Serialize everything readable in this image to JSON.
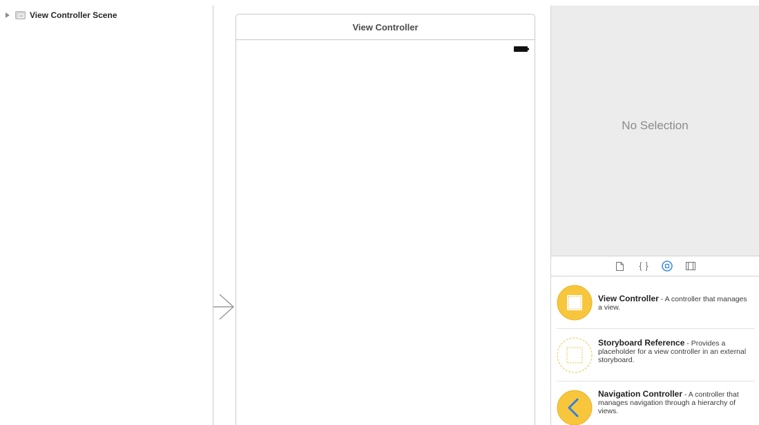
{
  "outline": {
    "scene_label": "View Controller Scene"
  },
  "canvas": {
    "scene_title": "View Controller"
  },
  "inspector": {
    "empty_text": "No Selection"
  },
  "library": {
    "tabs": [
      {
        "name": "file-template",
        "icon": "file-icon"
      },
      {
        "name": "code-snippet",
        "icon": "braces-icon"
      },
      {
        "name": "object",
        "icon": "circle-square-icon",
        "selected": true
      },
      {
        "name": "media",
        "icon": "film-icon"
      }
    ],
    "items": [
      {
        "name": "View Controller",
        "separator": " - ",
        "description": "A controller that manages a view."
      },
      {
        "name": "Storyboard Reference",
        "separator": " - ",
        "description": "Provides a placeholder for a view controller in an external storyboard."
      },
      {
        "name": "Navigation Controller",
        "separator": " - ",
        "description": "A controller that manages navigation through a hierarchy of views."
      }
    ]
  },
  "colors": {
    "accent_blue": "#3d8de8",
    "library_yellow": "#f8c63c",
    "library_yellow_border": "#e9b22a",
    "inspector_bg": "#ececec"
  }
}
